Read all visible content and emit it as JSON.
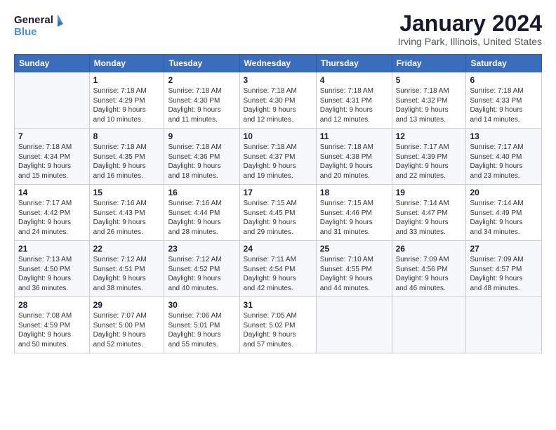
{
  "logo": {
    "line1": "General",
    "line2": "Blue"
  },
  "title": "January 2024",
  "subtitle": "Irving Park, Illinois, United States",
  "weekdays": [
    "Sunday",
    "Monday",
    "Tuesday",
    "Wednesday",
    "Thursday",
    "Friday",
    "Saturday"
  ],
  "weeks": [
    [
      {
        "num": "",
        "info": ""
      },
      {
        "num": "1",
        "info": "Sunrise: 7:18 AM\nSunset: 4:29 PM\nDaylight: 9 hours\nand 10 minutes."
      },
      {
        "num": "2",
        "info": "Sunrise: 7:18 AM\nSunset: 4:30 PM\nDaylight: 9 hours\nand 11 minutes."
      },
      {
        "num": "3",
        "info": "Sunrise: 7:18 AM\nSunset: 4:30 PM\nDaylight: 9 hours\nand 12 minutes."
      },
      {
        "num": "4",
        "info": "Sunrise: 7:18 AM\nSunset: 4:31 PM\nDaylight: 9 hours\nand 12 minutes."
      },
      {
        "num": "5",
        "info": "Sunrise: 7:18 AM\nSunset: 4:32 PM\nDaylight: 9 hours\nand 13 minutes."
      },
      {
        "num": "6",
        "info": "Sunrise: 7:18 AM\nSunset: 4:33 PM\nDaylight: 9 hours\nand 14 minutes."
      }
    ],
    [
      {
        "num": "7",
        "info": "Sunrise: 7:18 AM\nSunset: 4:34 PM\nDaylight: 9 hours\nand 15 minutes."
      },
      {
        "num": "8",
        "info": "Sunrise: 7:18 AM\nSunset: 4:35 PM\nDaylight: 9 hours\nand 16 minutes."
      },
      {
        "num": "9",
        "info": "Sunrise: 7:18 AM\nSunset: 4:36 PM\nDaylight: 9 hours\nand 18 minutes."
      },
      {
        "num": "10",
        "info": "Sunrise: 7:18 AM\nSunset: 4:37 PM\nDaylight: 9 hours\nand 19 minutes."
      },
      {
        "num": "11",
        "info": "Sunrise: 7:18 AM\nSunset: 4:38 PM\nDaylight: 9 hours\nand 20 minutes."
      },
      {
        "num": "12",
        "info": "Sunrise: 7:17 AM\nSunset: 4:39 PM\nDaylight: 9 hours\nand 22 minutes."
      },
      {
        "num": "13",
        "info": "Sunrise: 7:17 AM\nSunset: 4:40 PM\nDaylight: 9 hours\nand 23 minutes."
      }
    ],
    [
      {
        "num": "14",
        "info": "Sunrise: 7:17 AM\nSunset: 4:42 PM\nDaylight: 9 hours\nand 24 minutes."
      },
      {
        "num": "15",
        "info": "Sunrise: 7:16 AM\nSunset: 4:43 PM\nDaylight: 9 hours\nand 26 minutes."
      },
      {
        "num": "16",
        "info": "Sunrise: 7:16 AM\nSunset: 4:44 PM\nDaylight: 9 hours\nand 28 minutes."
      },
      {
        "num": "17",
        "info": "Sunrise: 7:15 AM\nSunset: 4:45 PM\nDaylight: 9 hours\nand 29 minutes."
      },
      {
        "num": "18",
        "info": "Sunrise: 7:15 AM\nSunset: 4:46 PM\nDaylight: 9 hours\nand 31 minutes."
      },
      {
        "num": "19",
        "info": "Sunrise: 7:14 AM\nSunset: 4:47 PM\nDaylight: 9 hours\nand 33 minutes."
      },
      {
        "num": "20",
        "info": "Sunrise: 7:14 AM\nSunset: 4:49 PM\nDaylight: 9 hours\nand 34 minutes."
      }
    ],
    [
      {
        "num": "21",
        "info": "Sunrise: 7:13 AM\nSunset: 4:50 PM\nDaylight: 9 hours\nand 36 minutes."
      },
      {
        "num": "22",
        "info": "Sunrise: 7:12 AM\nSunset: 4:51 PM\nDaylight: 9 hours\nand 38 minutes."
      },
      {
        "num": "23",
        "info": "Sunrise: 7:12 AM\nSunset: 4:52 PM\nDaylight: 9 hours\nand 40 minutes."
      },
      {
        "num": "24",
        "info": "Sunrise: 7:11 AM\nSunset: 4:54 PM\nDaylight: 9 hours\nand 42 minutes."
      },
      {
        "num": "25",
        "info": "Sunrise: 7:10 AM\nSunset: 4:55 PM\nDaylight: 9 hours\nand 44 minutes."
      },
      {
        "num": "26",
        "info": "Sunrise: 7:09 AM\nSunset: 4:56 PM\nDaylight: 9 hours\nand 46 minutes."
      },
      {
        "num": "27",
        "info": "Sunrise: 7:09 AM\nSunset: 4:57 PM\nDaylight: 9 hours\nand 48 minutes."
      }
    ],
    [
      {
        "num": "28",
        "info": "Sunrise: 7:08 AM\nSunset: 4:59 PM\nDaylight: 9 hours\nand 50 minutes."
      },
      {
        "num": "29",
        "info": "Sunrise: 7:07 AM\nSunset: 5:00 PM\nDaylight: 9 hours\nand 52 minutes."
      },
      {
        "num": "30",
        "info": "Sunrise: 7:06 AM\nSunset: 5:01 PM\nDaylight: 9 hours\nand 55 minutes."
      },
      {
        "num": "31",
        "info": "Sunrise: 7:05 AM\nSunset: 5:02 PM\nDaylight: 9 hours\nand 57 minutes."
      },
      {
        "num": "",
        "info": ""
      },
      {
        "num": "",
        "info": ""
      },
      {
        "num": "",
        "info": ""
      }
    ]
  ]
}
